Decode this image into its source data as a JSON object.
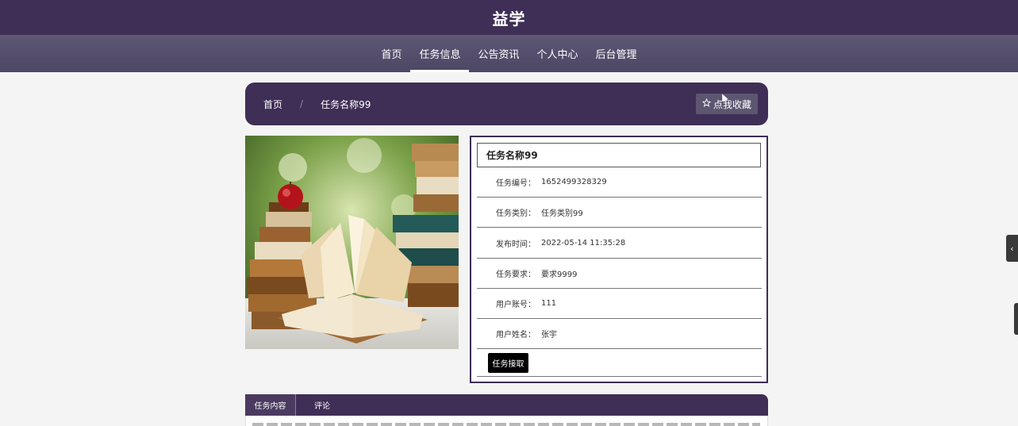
{
  "header": {
    "title": "益学"
  },
  "nav": {
    "items": [
      {
        "label": "首页"
      },
      {
        "label": "任务信息",
        "active": true
      },
      {
        "label": "公告资讯"
      },
      {
        "label": "个人中心"
      },
      {
        "label": "后台管理"
      }
    ]
  },
  "breadcrumb": {
    "home": "首页",
    "separator": "/",
    "current": "任务名称99",
    "favorite_label": "点我收藏",
    "favorite_icon": "star-outline-icon"
  },
  "task": {
    "title": "任务名称99",
    "rows": [
      {
        "label": "任务编号：",
        "value": "1652499328329"
      },
      {
        "label": "任务类别：",
        "value": "任务类别99"
      },
      {
        "label": "发布时间：",
        "value": "2022-05-14 11:35:28"
      },
      {
        "label": "任务要求：",
        "value": "要求9999"
      },
      {
        "label": "用户账号：",
        "value": "111"
      },
      {
        "label": "用户姓名：",
        "value": "张宇"
      }
    ],
    "accept_label": "任务接取"
  },
  "tabs": [
    {
      "label": "任务内容",
      "active": true
    },
    {
      "label": "评论"
    }
  ],
  "side_tab_icon": "chevron-left-icon",
  "colors": {
    "primary": "#3f2e55",
    "nav": "#5e5775",
    "button": "#000000"
  }
}
